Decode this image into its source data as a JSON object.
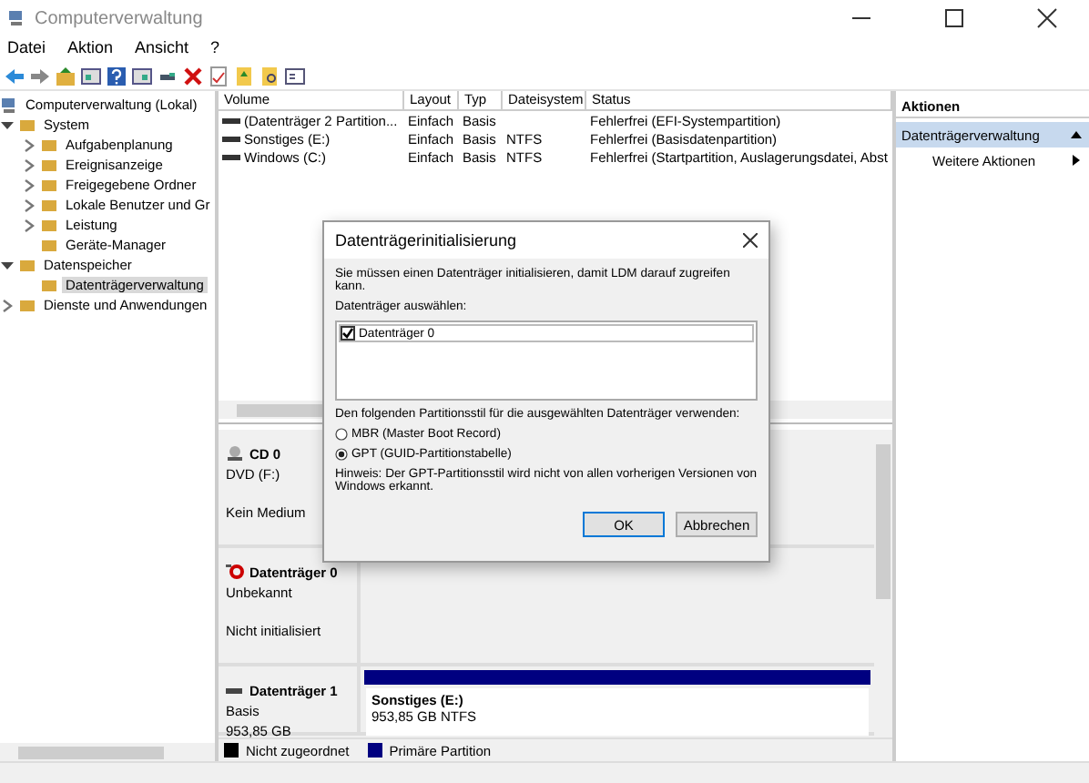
{
  "window": {
    "title": "Computerverwaltung"
  },
  "menu": [
    "Datei",
    "Aktion",
    "Ansicht",
    "?"
  ],
  "tree": {
    "root": "Computerverwaltung (Lokal)",
    "children": [
      {
        "label": "System",
        "kind": "branch",
        "expanded": true,
        "selected": false,
        "children": [
          {
            "label": "Aufgabenplanung",
            "kind": "branch",
            "expanded": false,
            "selected": false
          },
          {
            "label": "Ereignisanzeige",
            "kind": "branch",
            "expanded": false,
            "selected": false
          },
          {
            "label": "Freigegebene Ordner",
            "kind": "branch",
            "expanded": false,
            "selected": false
          },
          {
            "label": "Lokale Benutzer und Gr",
            "kind": "branch",
            "expanded": false,
            "selected": false
          },
          {
            "label": "Leistung",
            "kind": "branch",
            "expanded": false,
            "selected": false
          },
          {
            "label": "Geräte-Manager",
            "kind": "leaf",
            "selected": false
          }
        ]
      },
      {
        "label": "Datenspeicher",
        "kind": "branch",
        "expanded": true,
        "selected": false,
        "children": [
          {
            "label": "Datenträgerverwaltung",
            "kind": "leaf",
            "selected": true
          }
        ]
      },
      {
        "label": "Dienste und Anwendungen",
        "kind": "branch",
        "expanded": false,
        "selected": false
      }
    ]
  },
  "volumes": {
    "columns": [
      "Volume",
      "Layout",
      "Typ",
      "Dateisystem",
      "Status"
    ],
    "rows": [
      [
        "(Datenträger 2 Partition...",
        "Einfach",
        "Basis",
        "",
        "Fehlerfrei (EFI-Systempartition)"
      ],
      [
        "Sonstiges (E:)",
        "Einfach",
        "Basis",
        "NTFS",
        "Fehlerfrei (Basisdatenpartition)"
      ],
      [
        "Windows (C:)",
        "Einfach",
        "Basis",
        "NTFS",
        "Fehlerfrei (Startpartition, Auslagerungsdatei, Abst"
      ]
    ]
  },
  "disks": [
    {
      "kind": "cdrom",
      "name": "CD 0",
      "type": "DVD (F:)",
      "info": "Kein Medium"
    },
    {
      "kind": "unknown",
      "name": "Datenträger 0",
      "type": "Unbekannt",
      "info": "Nicht initialisiert"
    },
    {
      "kind": "basic",
      "name": "Datenträger 1",
      "type": "Basis",
      "info": "953,85 GB",
      "partition": {
        "name": "Sonstiges  (E:)",
        "detail": "953,85 GB NTFS",
        "color": "#000080"
      }
    }
  ],
  "legend": [
    {
      "label": "Nicht zugeordnet",
      "color": "#000000"
    },
    {
      "label": "Primäre Partition",
      "color": "#000080"
    }
  ],
  "actions": {
    "title": "Aktionen",
    "section": "Datenträgerverwaltung",
    "items": [
      "Weitere Aktionen"
    ]
  },
  "dialog": {
    "title": "Datenträgerinitialisierung",
    "message": "Sie müssen einen Datenträger initialisieren, damit LDM darauf zugreifen kann.",
    "list_label": "Datenträger auswählen:",
    "disks": [
      {
        "label": "Datenträger 0",
        "checked": true
      }
    ],
    "style_label": "Den folgenden Partitionsstil für die ausgewählten Datenträger verwenden:",
    "styles": [
      {
        "label": "MBR (Master Boot Record)",
        "selected": false
      },
      {
        "label": "GPT (GUID-Partitionstabelle)",
        "selected": true
      }
    ],
    "hint": "Hinweis: Der GPT-Partitionsstil wird nicht von allen vorherigen Versionen von Windows erkannt.",
    "buttons": [
      {
        "label": "OK",
        "default": true
      },
      {
        "label": "Abbrechen",
        "default": false
      }
    ]
  }
}
